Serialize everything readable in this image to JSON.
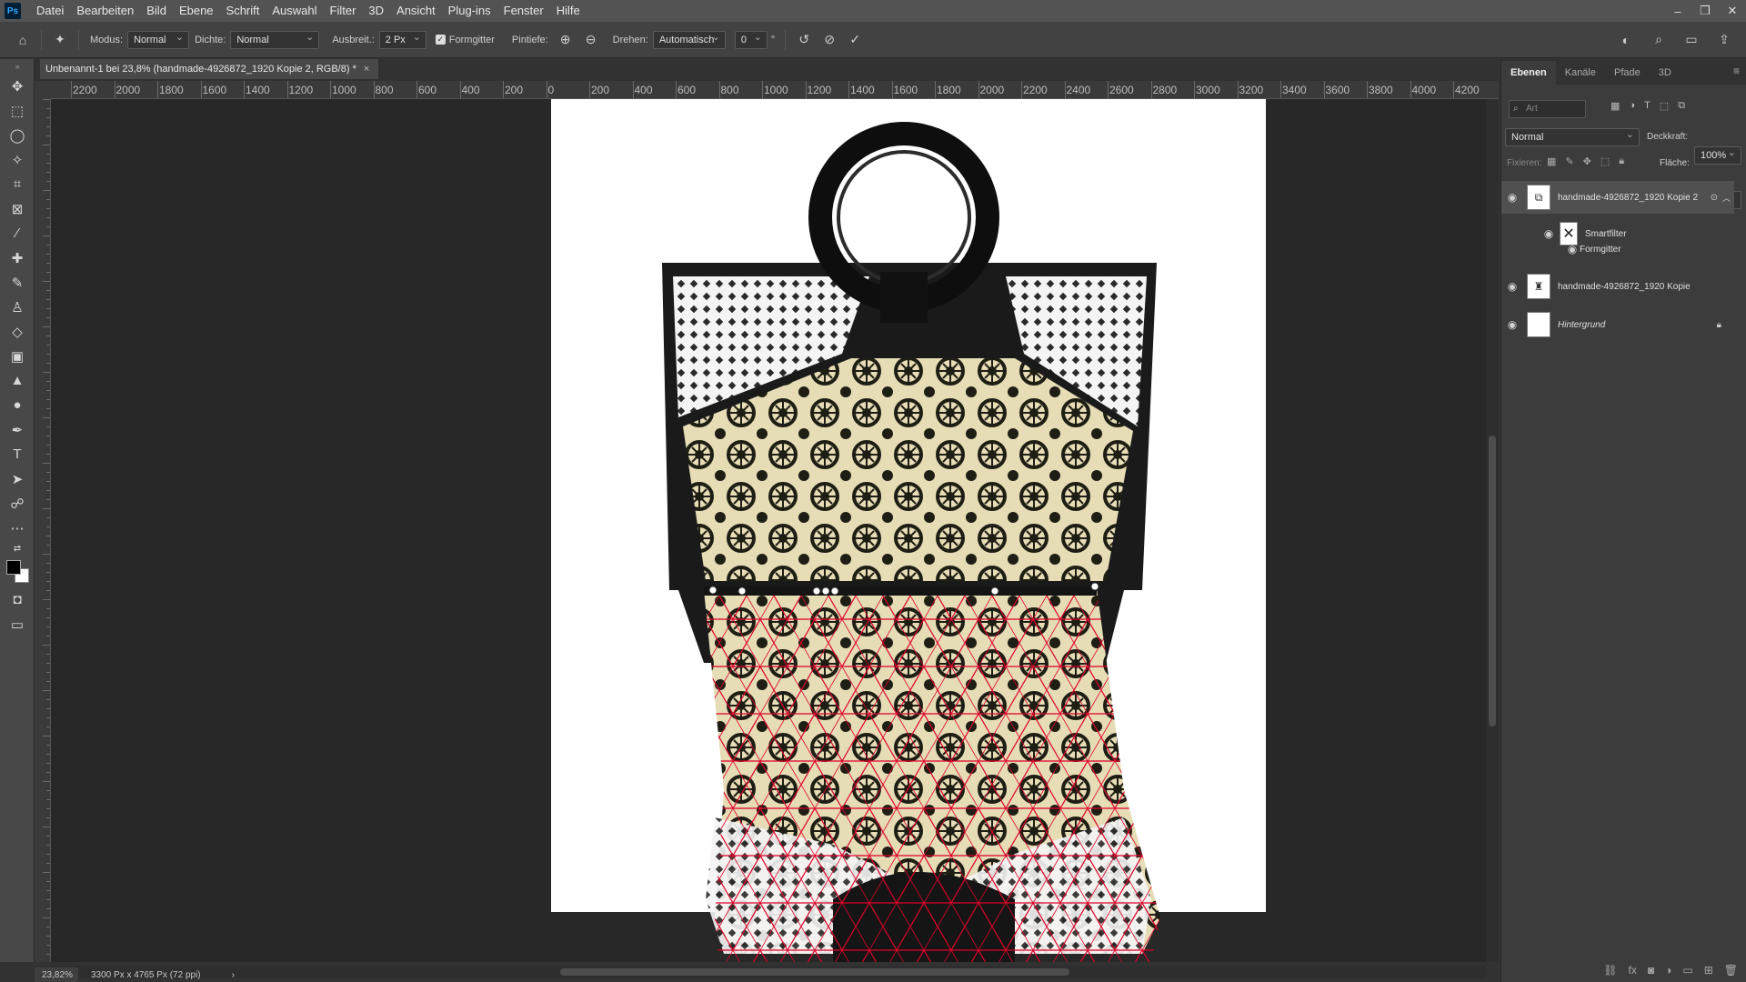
{
  "menu": {
    "app_logo": "Ps",
    "items": [
      "Datei",
      "Bearbeiten",
      "Bild",
      "Ebene",
      "Schrift",
      "Auswahl",
      "Filter",
      "3D",
      "Ansicht",
      "Plug-ins",
      "Fenster",
      "Hilfe"
    ]
  },
  "window_controls": {
    "minimize": "–",
    "restore": "❐",
    "close": "✕"
  },
  "options": {
    "modus_label": "Modus:",
    "modus_value": "Normal",
    "dichte_label": "Dichte:",
    "dichte_value": "Normal",
    "ausbreit_label": "Ausbreit.:",
    "ausbreit_value": "2 Px",
    "formgitter_label": "Formgitter",
    "pintiefe_label": "Pintiefe:",
    "drehen_label": "Drehen:",
    "drehen_value": "Automatisch",
    "angle_value": "0",
    "angle_unit": "°"
  },
  "document": {
    "tab_title": "Unbenannt-1 bei 23,8% (handmade-4926872_1920 Kopie 2, RGB/8) *",
    "tab_close": "×"
  },
  "ruler_h_labels": [
    "2200",
    "2000",
    "1800",
    "1600",
    "1400",
    "1200",
    "1000",
    "800",
    "600",
    "400",
    "200",
    "0",
    "200",
    "400",
    "600",
    "800",
    "1000",
    "1200",
    "1400",
    "1600",
    "1800",
    "2000",
    "2200",
    "2400",
    "2600",
    "2800",
    "3000",
    "3200",
    "3400",
    "3600",
    "3800",
    "4000",
    "4200"
  ],
  "status": {
    "zoom": "23,82%",
    "doc_size": "3300 Px x 4765 Px (72 ppi)",
    "arrow": "›"
  },
  "panel": {
    "tabs": [
      "Ebenen",
      "Kanäle",
      "Pfade",
      "3D"
    ],
    "active_tab": "Ebenen",
    "search_placeholder": "Art",
    "blend_mode": "Normal",
    "opacity_label": "Deckkraft:",
    "opacity_value": "100%",
    "lock_label": "Fixieren:",
    "fill_label": "Fläche:",
    "fill_value": "100%",
    "layers": [
      {
        "name": "handmade-4926872_1920 Kopie 2"
      },
      {
        "name": "Smartfilter"
      },
      {
        "name": "Formgitter"
      },
      {
        "name": "handmade-4926872_1920 Kopie"
      },
      {
        "name": "Hintergrund"
      }
    ]
  },
  "colors": {
    "mesh": "#e0002a",
    "pattern_dark": "#1e1e14",
    "pattern_light": "#e8dcb4"
  }
}
